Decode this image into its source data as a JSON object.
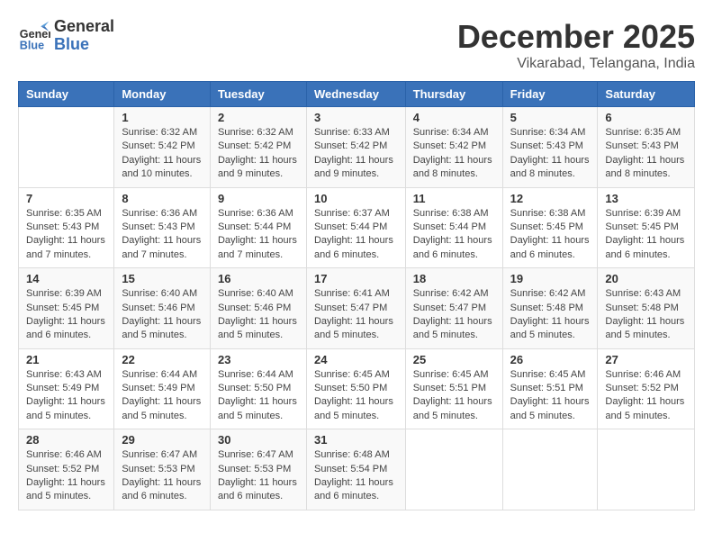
{
  "logo": {
    "line1": "General",
    "line2": "Blue"
  },
  "title": "December 2025",
  "location": "Vikarabad, Telangana, India",
  "headers": [
    "Sunday",
    "Monday",
    "Tuesday",
    "Wednesday",
    "Thursday",
    "Friday",
    "Saturday"
  ],
  "weeks": [
    [
      {
        "day": "",
        "info": ""
      },
      {
        "day": "1",
        "info": "Sunrise: 6:32 AM\nSunset: 5:42 PM\nDaylight: 11 hours and 10 minutes."
      },
      {
        "day": "2",
        "info": "Sunrise: 6:32 AM\nSunset: 5:42 PM\nDaylight: 11 hours and 9 minutes."
      },
      {
        "day": "3",
        "info": "Sunrise: 6:33 AM\nSunset: 5:42 PM\nDaylight: 11 hours and 9 minutes."
      },
      {
        "day": "4",
        "info": "Sunrise: 6:34 AM\nSunset: 5:42 PM\nDaylight: 11 hours and 8 minutes."
      },
      {
        "day": "5",
        "info": "Sunrise: 6:34 AM\nSunset: 5:43 PM\nDaylight: 11 hours and 8 minutes."
      },
      {
        "day": "6",
        "info": "Sunrise: 6:35 AM\nSunset: 5:43 PM\nDaylight: 11 hours and 8 minutes."
      }
    ],
    [
      {
        "day": "7",
        "info": "Sunrise: 6:35 AM\nSunset: 5:43 PM\nDaylight: 11 hours and 7 minutes."
      },
      {
        "day": "8",
        "info": "Sunrise: 6:36 AM\nSunset: 5:43 PM\nDaylight: 11 hours and 7 minutes."
      },
      {
        "day": "9",
        "info": "Sunrise: 6:36 AM\nSunset: 5:44 PM\nDaylight: 11 hours and 7 minutes."
      },
      {
        "day": "10",
        "info": "Sunrise: 6:37 AM\nSunset: 5:44 PM\nDaylight: 11 hours and 6 minutes."
      },
      {
        "day": "11",
        "info": "Sunrise: 6:38 AM\nSunset: 5:44 PM\nDaylight: 11 hours and 6 minutes."
      },
      {
        "day": "12",
        "info": "Sunrise: 6:38 AM\nSunset: 5:45 PM\nDaylight: 11 hours and 6 minutes."
      },
      {
        "day": "13",
        "info": "Sunrise: 6:39 AM\nSunset: 5:45 PM\nDaylight: 11 hours and 6 minutes."
      }
    ],
    [
      {
        "day": "14",
        "info": "Sunrise: 6:39 AM\nSunset: 5:45 PM\nDaylight: 11 hours and 6 minutes."
      },
      {
        "day": "15",
        "info": "Sunrise: 6:40 AM\nSunset: 5:46 PM\nDaylight: 11 hours and 5 minutes."
      },
      {
        "day": "16",
        "info": "Sunrise: 6:40 AM\nSunset: 5:46 PM\nDaylight: 11 hours and 5 minutes."
      },
      {
        "day": "17",
        "info": "Sunrise: 6:41 AM\nSunset: 5:47 PM\nDaylight: 11 hours and 5 minutes."
      },
      {
        "day": "18",
        "info": "Sunrise: 6:42 AM\nSunset: 5:47 PM\nDaylight: 11 hours and 5 minutes."
      },
      {
        "day": "19",
        "info": "Sunrise: 6:42 AM\nSunset: 5:48 PM\nDaylight: 11 hours and 5 minutes."
      },
      {
        "day": "20",
        "info": "Sunrise: 6:43 AM\nSunset: 5:48 PM\nDaylight: 11 hours and 5 minutes."
      }
    ],
    [
      {
        "day": "21",
        "info": "Sunrise: 6:43 AM\nSunset: 5:49 PM\nDaylight: 11 hours and 5 minutes."
      },
      {
        "day": "22",
        "info": "Sunrise: 6:44 AM\nSunset: 5:49 PM\nDaylight: 11 hours and 5 minutes."
      },
      {
        "day": "23",
        "info": "Sunrise: 6:44 AM\nSunset: 5:50 PM\nDaylight: 11 hours and 5 minutes."
      },
      {
        "day": "24",
        "info": "Sunrise: 6:45 AM\nSunset: 5:50 PM\nDaylight: 11 hours and 5 minutes."
      },
      {
        "day": "25",
        "info": "Sunrise: 6:45 AM\nSunset: 5:51 PM\nDaylight: 11 hours and 5 minutes."
      },
      {
        "day": "26",
        "info": "Sunrise: 6:45 AM\nSunset: 5:51 PM\nDaylight: 11 hours and 5 minutes."
      },
      {
        "day": "27",
        "info": "Sunrise: 6:46 AM\nSunset: 5:52 PM\nDaylight: 11 hours and 5 minutes."
      }
    ],
    [
      {
        "day": "28",
        "info": "Sunrise: 6:46 AM\nSunset: 5:52 PM\nDaylight: 11 hours and 5 minutes."
      },
      {
        "day": "29",
        "info": "Sunrise: 6:47 AM\nSunset: 5:53 PM\nDaylight: 11 hours and 6 minutes."
      },
      {
        "day": "30",
        "info": "Sunrise: 6:47 AM\nSunset: 5:53 PM\nDaylight: 11 hours and 6 minutes."
      },
      {
        "day": "31",
        "info": "Sunrise: 6:48 AM\nSunset: 5:54 PM\nDaylight: 11 hours and 6 minutes."
      },
      {
        "day": "",
        "info": ""
      },
      {
        "day": "",
        "info": ""
      },
      {
        "day": "",
        "info": ""
      }
    ]
  ]
}
